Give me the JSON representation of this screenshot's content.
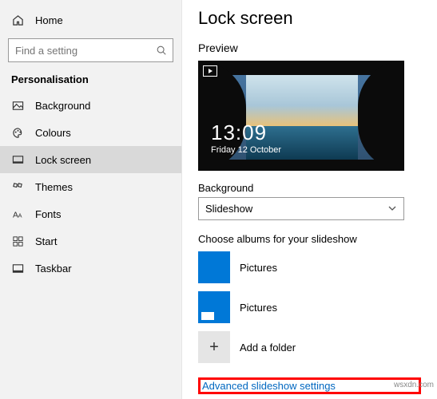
{
  "sidebar": {
    "home": "Home",
    "search_placeholder": "Find a setting",
    "section": "Personalisation",
    "items": [
      {
        "label": "Background"
      },
      {
        "label": "Colours"
      },
      {
        "label": "Lock screen"
      },
      {
        "label": "Themes"
      },
      {
        "label": "Fonts"
      },
      {
        "label": "Start"
      },
      {
        "label": "Taskbar"
      }
    ]
  },
  "main": {
    "title": "Lock screen",
    "preview_label": "Preview",
    "clock_time": "13:09",
    "clock_date": "Friday 12 October",
    "bg_label": "Background",
    "bg_value": "Slideshow",
    "albums_label": "Choose albums for your slideshow",
    "albums": [
      {
        "label": "Pictures"
      },
      {
        "label": "Pictures"
      }
    ],
    "add_folder": "Add a folder",
    "advanced_link": "Advanced slideshow settings"
  },
  "watermark": "wsxdn.com"
}
